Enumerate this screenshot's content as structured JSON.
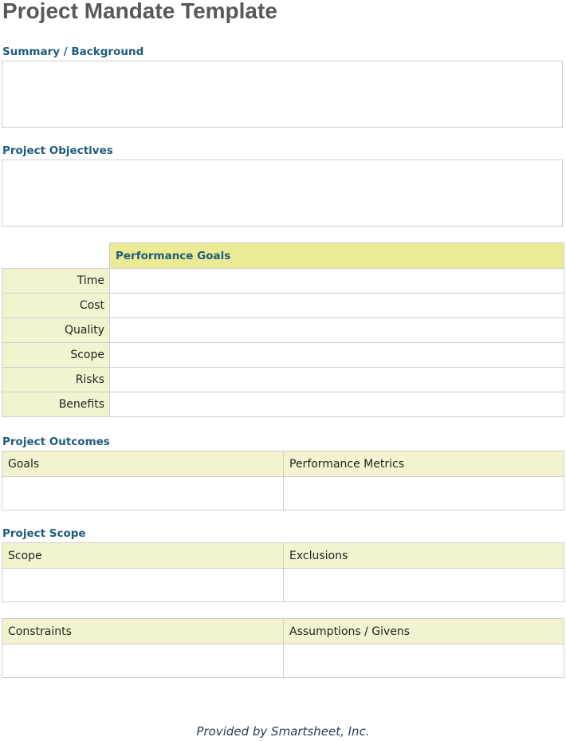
{
  "title": "Project Mandate Template",
  "sections": {
    "summary": "Summary / Background",
    "objectives": "Project Objectives",
    "outcomes": "Project Outcomes",
    "scope": "Project Scope"
  },
  "performance_goals": {
    "heading": "Performance Goals",
    "rows": [
      "Time",
      "Cost",
      "Quality",
      "Scope",
      "Risks",
      "Benefits"
    ]
  },
  "outcomes_table": {
    "col1": "Goals",
    "col2": "Performance Metrics"
  },
  "scope_table": {
    "col1": "Scope",
    "col2": "Exclusions"
  },
  "constraints_table": {
    "col1": "Constraints",
    "col2": "Assumptions / Givens"
  },
  "footer": "Provided by Smartsheet, Inc.",
  "colors": {
    "heading_blue": "#1f5c7a",
    "header_yellow": "#ebeb96",
    "label_yellow": "#f3f4cf",
    "title_gray": "#595959"
  }
}
